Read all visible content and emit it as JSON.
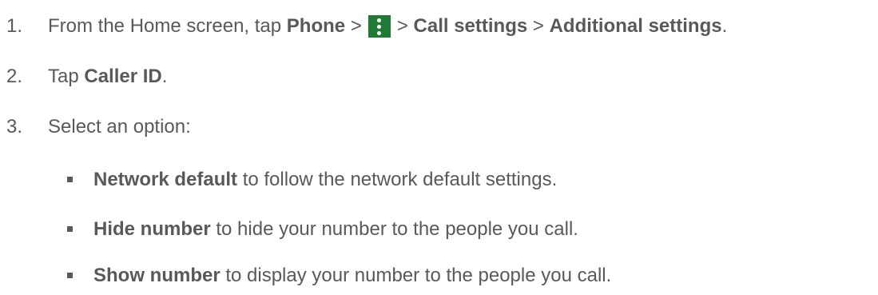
{
  "steps": [
    {
      "number": "1.",
      "intro": "From the Home screen, tap",
      "phone": "Phone",
      "sep1": ">",
      "menu_icon": "three-dot-menu-icon",
      "sep2": ">",
      "call_settings": "Call settings",
      "sep3": ">",
      "additional_settings": "Additional settings",
      "end": "."
    },
    {
      "number": "2.",
      "intro": "Tap",
      "caller_id": "Caller ID",
      "end": "."
    },
    {
      "number": "3.",
      "text": "Select an option:"
    }
  ],
  "options": [
    {
      "bold": "Network default",
      "rest": " to follow the network default settings."
    },
    {
      "bold": "Hide number",
      "rest": " to hide your number to the people you call."
    },
    {
      "bold": "Show number",
      "rest": " to display your number to the people you call."
    }
  ],
  "colors": {
    "text": "#595959",
    "menu_icon_bg": "#1f7a35"
  }
}
